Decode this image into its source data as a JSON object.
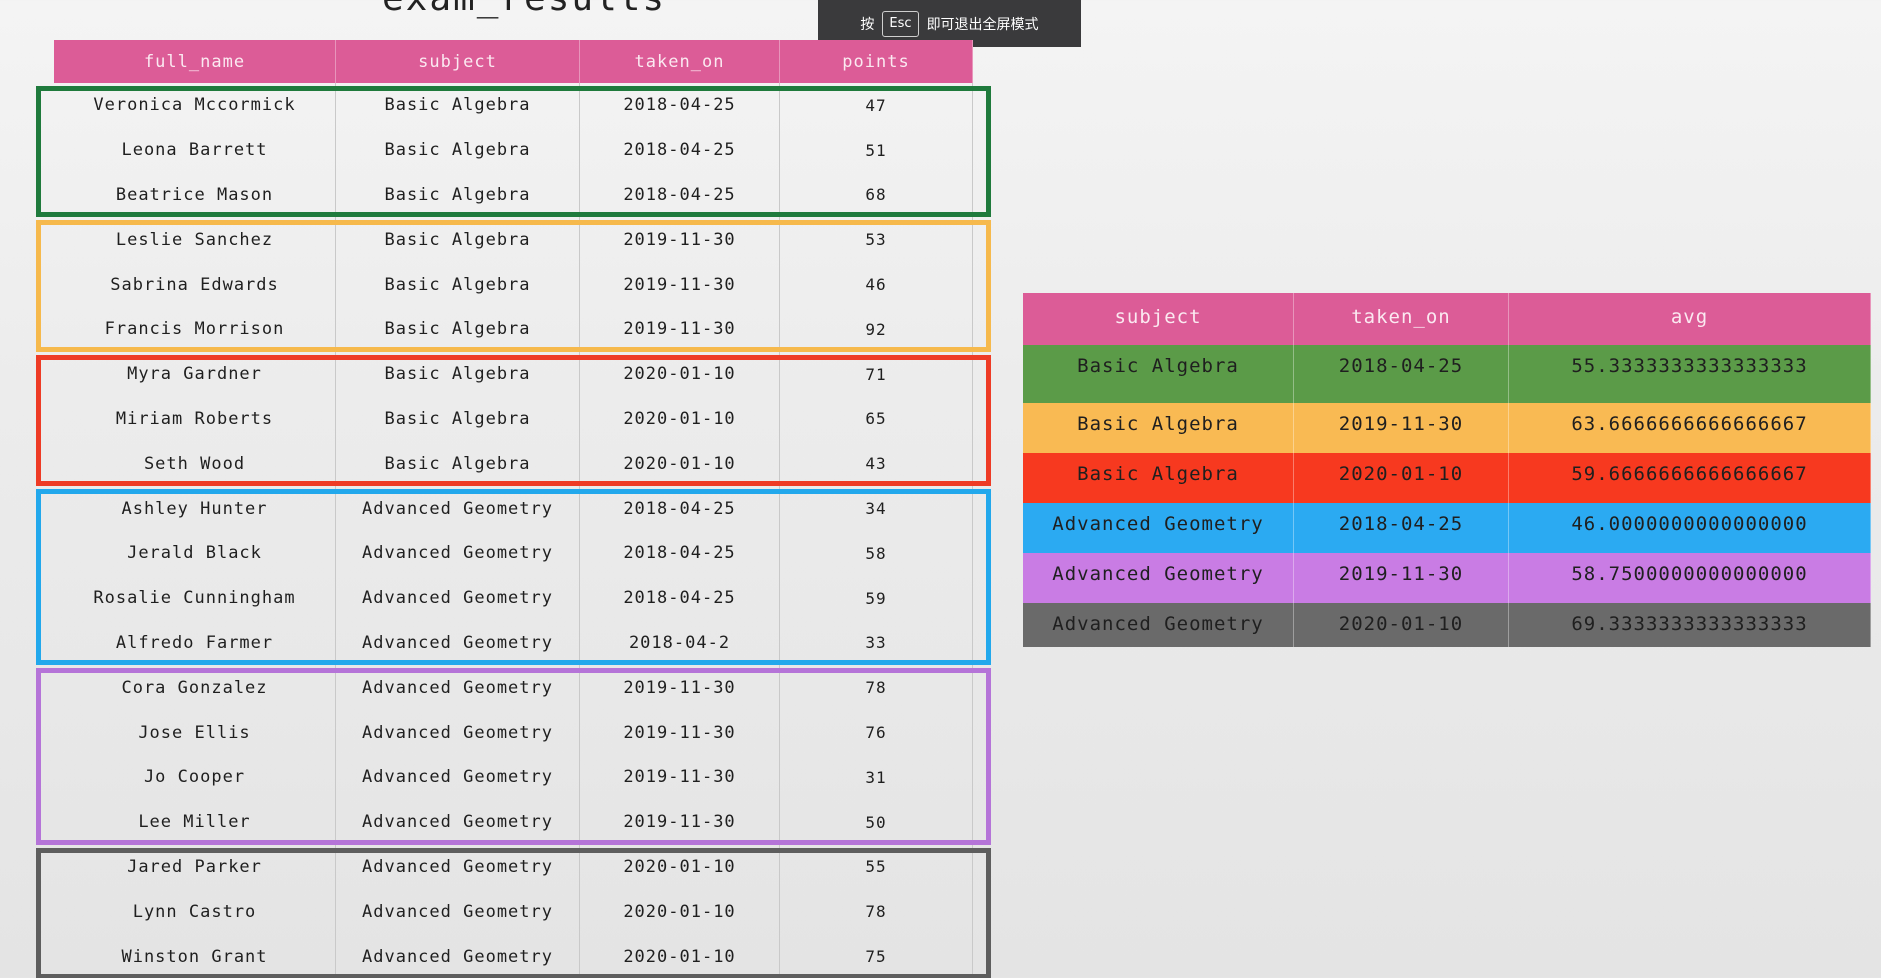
{
  "title": "exam_results",
  "fullscreen_toast": {
    "prefix": "按",
    "key": "Esc",
    "suffix": "即可退出全屏模式"
  },
  "exam_results": {
    "columns": [
      "full_name",
      "subject",
      "taken_on",
      "points"
    ],
    "rows": [
      [
        "Veronica Mccormick",
        "Basic Algebra",
        "2018-04-25",
        "47"
      ],
      [
        "Leona Barrett",
        "Basic Algebra",
        "2018-04-25",
        "51"
      ],
      [
        "Beatrice Mason",
        "Basic Algebra",
        "2018-04-25",
        "68"
      ],
      [
        "Leslie Sanchez",
        "Basic Algebra",
        "2019-11-30",
        "53"
      ],
      [
        "Sabrina Edwards",
        "Basic Algebra",
        "2019-11-30",
        "46"
      ],
      [
        "Francis Morrison",
        "Basic Algebra",
        "2019-11-30",
        "92"
      ],
      [
        "Myra Gardner",
        "Basic Algebra",
        "2020-01-10",
        "71"
      ],
      [
        "Miriam Roberts",
        "Basic Algebra",
        "2020-01-10",
        "65"
      ],
      [
        "Seth Wood",
        "Basic Algebra",
        "2020-01-10",
        "43"
      ],
      [
        "Ashley Hunter",
        "Advanced Geometry",
        "2018-04-25",
        "34"
      ],
      [
        "Jerald Black",
        "Advanced Geometry",
        "2018-04-25",
        "58"
      ],
      [
        "Rosalie Cunningham",
        "Advanced Geometry",
        "2018-04-25",
        "59"
      ],
      [
        "Alfredo Farmer",
        "Advanced Geometry",
        "2018-04-2",
        "33"
      ],
      [
        "Cora Gonzalez",
        "Advanced Geometry",
        "2019-11-30",
        "78"
      ],
      [
        "Jose Ellis",
        "Advanced Geometry",
        "2019-11-30",
        "76"
      ],
      [
        "Jo Cooper",
        "Advanced Geometry",
        "2019-11-30",
        "31"
      ],
      [
        "Lee Miller",
        "Advanced Geometry",
        "2019-11-30",
        "50"
      ],
      [
        "Jared Parker",
        "Advanced Geometry",
        "2020-01-10",
        "55"
      ],
      [
        "Lynn Castro",
        "Advanced Geometry",
        "2020-01-10",
        "78"
      ],
      [
        "Winston Grant",
        "Advanced Geometry",
        "2020-01-10",
        "75"
      ]
    ],
    "groups": [
      {
        "first_row": 0,
        "row_count": 3,
        "color": "#1f7a3c"
      },
      {
        "first_row": 3,
        "row_count": 3,
        "color": "#f6b94c"
      },
      {
        "first_row": 6,
        "row_count": 3,
        "color": "#ee3b25"
      },
      {
        "first_row": 9,
        "row_count": 4,
        "color": "#22a8ec"
      },
      {
        "first_row": 13,
        "row_count": 4,
        "color": "#b574d8"
      },
      {
        "first_row": 17,
        "row_count": 3,
        "color": "#5e5e5e"
      }
    ]
  },
  "averages": {
    "columns": [
      "subject",
      "taken_on",
      "avg"
    ],
    "rows": [
      {
        "cells": [
          "Basic Algebra",
          "2018-04-25",
          "55.3333333333333333"
        ],
        "color": "#5b9b48"
      },
      {
        "cells": [
          "Basic Algebra",
          "2019-11-30",
          "63.6666666666666667"
        ],
        "color": "#f9ba53"
      },
      {
        "cells": [
          "Basic Algebra",
          "2020-01-10",
          "59.6666666666666667"
        ],
        "color": "#f7391f"
      },
      {
        "cells": [
          "Advanced Geometry",
          "2018-04-25",
          "46.0000000000000000"
        ],
        "color": "#2baaf2"
      },
      {
        "cells": [
          "Advanced Geometry",
          "2019-11-30",
          "58.7500000000000000"
        ],
        "color": "#c97ce4"
      },
      {
        "cells": [
          "Advanced Geometry",
          "2020-01-10",
          "69.3333333333333333"
        ],
        "color": "#6a6a6a"
      }
    ]
  }
}
